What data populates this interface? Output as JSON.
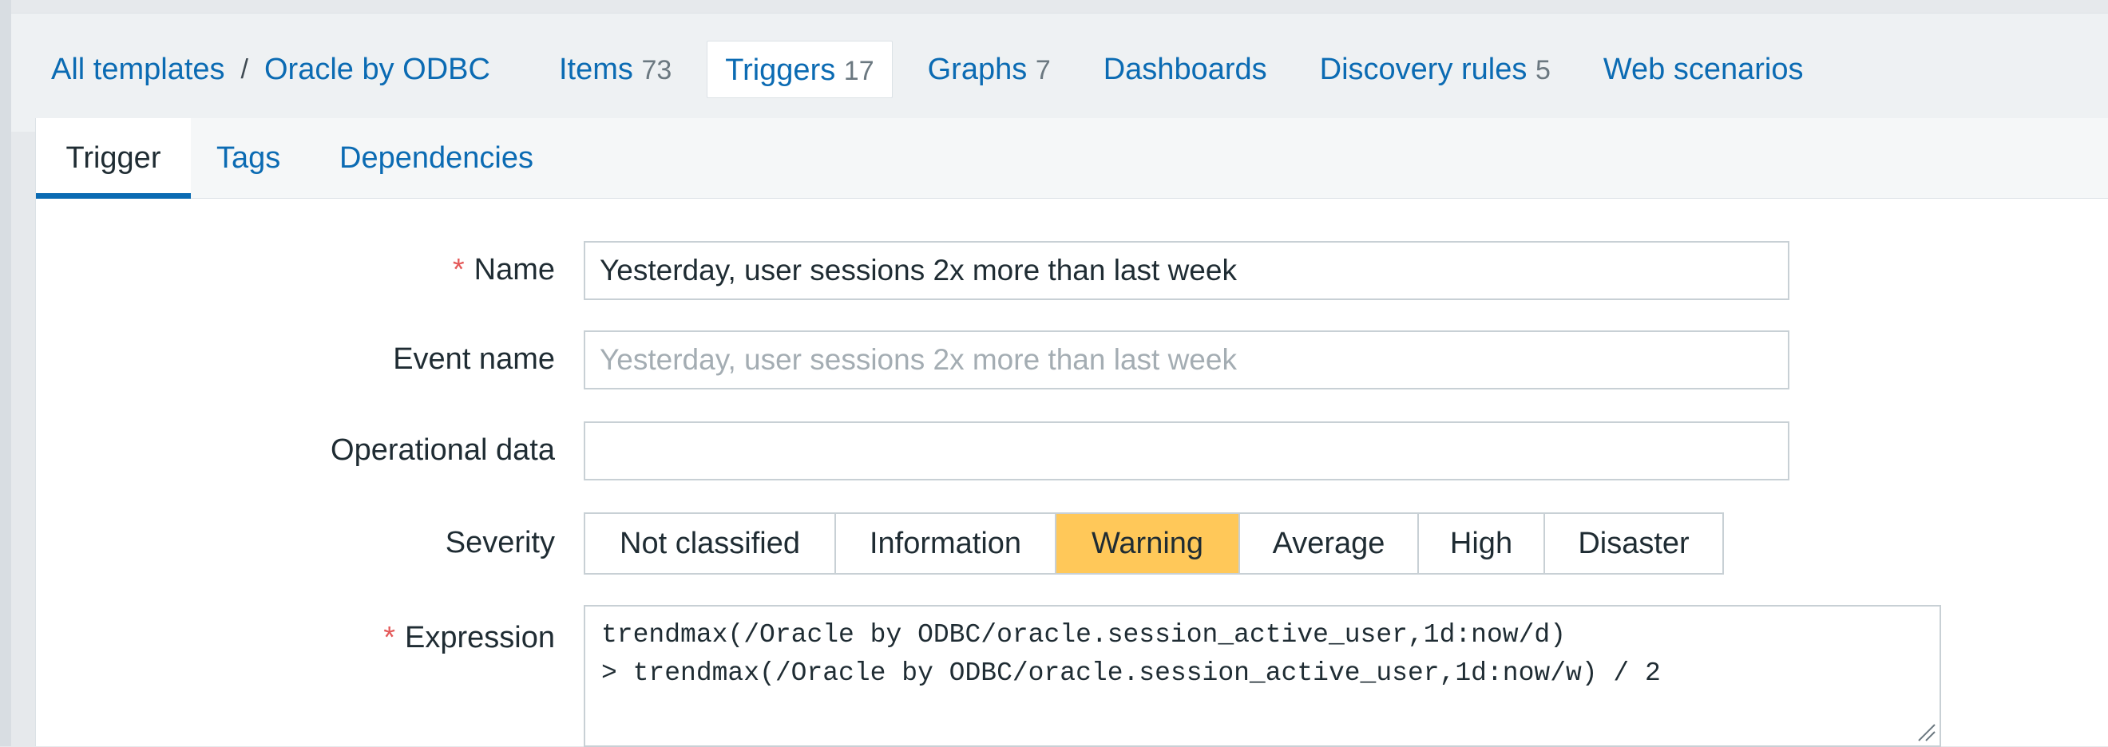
{
  "breadcrumb": {
    "all_templates": "All templates",
    "separator": "/",
    "template": "Oracle by ODBC"
  },
  "header_tabs": [
    {
      "label": "Items",
      "count": "73"
    },
    {
      "label": "Triggers",
      "count": "17"
    },
    {
      "label": "Graphs",
      "count": "7"
    },
    {
      "label": "Dashboards",
      "count": ""
    },
    {
      "label": "Discovery rules",
      "count": "5"
    },
    {
      "label": "Web scenarios",
      "count": ""
    }
  ],
  "sub_tabs": {
    "trigger": "Trigger",
    "tags": "Tags",
    "dependencies": "Dependencies"
  },
  "form": {
    "required_mark": "*",
    "name": {
      "label": "Name",
      "value": "Yesterday, user sessions 2x more than last week"
    },
    "event_name": {
      "label": "Event name",
      "placeholder": "Yesterday, user sessions 2x more than last week"
    },
    "operational_data": {
      "label": "Operational data",
      "value": ""
    },
    "severity": {
      "label": "Severity",
      "options": [
        "Not classified",
        "Information",
        "Warning",
        "Average",
        "High",
        "Disaster"
      ],
      "selected": "Warning"
    },
    "expression": {
      "label": "Expression",
      "line1": "trendmax(/Oracle by ODBC/oracle.session_active_user,1d:now/d)",
      "line2": "> trendmax(/Oracle by ODBC/oracle.session_active_user,1d:now/w) / 2"
    }
  },
  "colors": {
    "link": "#0b6bb3",
    "required": "#e45959",
    "warning": "#ffc859"
  }
}
